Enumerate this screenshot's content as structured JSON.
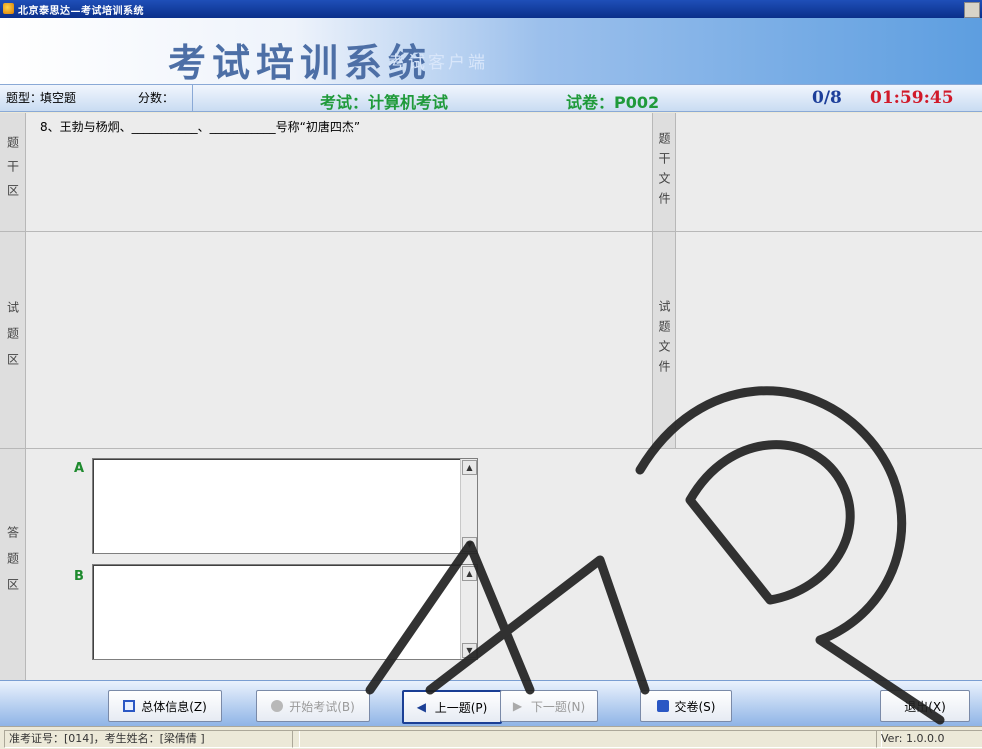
{
  "window": {
    "title": "北京泰思达—考试培训系统"
  },
  "banner": {
    "title": "考试培训系统",
    "subtitle": "考试客户端"
  },
  "info": {
    "type_label": "题型：",
    "type_value": "填空题",
    "score_label": "分数：",
    "score_value": "",
    "exam": "考试：计算机考试",
    "paper": "试卷：P002",
    "progress": "0/8",
    "timer": "01:59:45"
  },
  "sections": {
    "stem": "题干区",
    "stem_file": "题干文件",
    "question": "试题区",
    "question_file": "试题文件",
    "answer": "答题区"
  },
  "question_text": "8、王勃与杨炯、___________、___________号称“初唐四杰”",
  "answers": [
    {
      "letter": "A",
      "value": ""
    },
    {
      "letter": "B",
      "value": ""
    }
  ],
  "toolbar": {
    "summary": "总体信息(Z)",
    "start": "开始考试(B)",
    "prev": "上一题(P)",
    "next": "下一题(N)",
    "submit": "交卷(S)",
    "exit": "退出(X)"
  },
  "status": {
    "id_label": "准考证号：",
    "id_value": "[014]",
    "name_label": "，考生姓名：",
    "name_value": "[梁倩倩 ]",
    "version": "Ver: 1.0.0.0"
  },
  "watermark": {
    "text": "EAR"
  },
  "colors": {
    "accent_blue": "#4d6fa6",
    "green": "#1f9a3a",
    "timer_red": "#d11a2a"
  }
}
